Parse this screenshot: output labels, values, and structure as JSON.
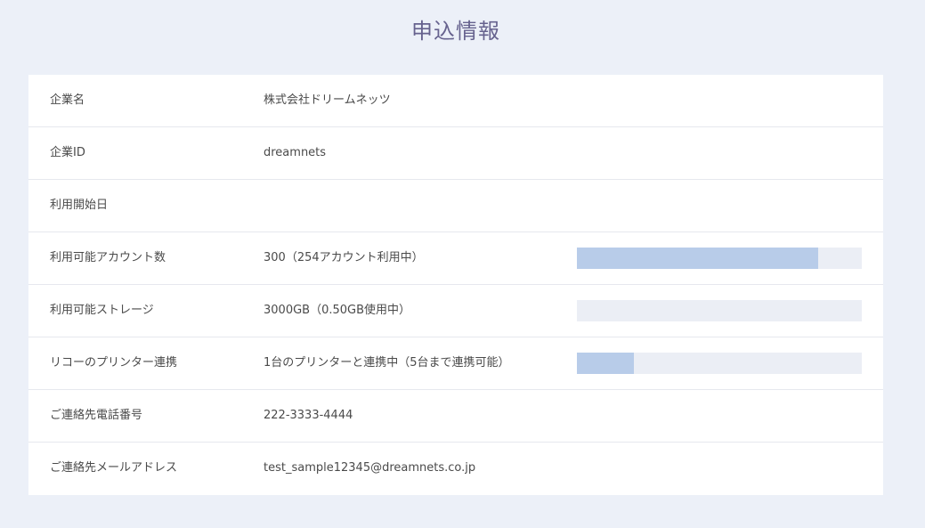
{
  "page": {
    "title": "申込情報"
  },
  "rows": [
    {
      "label": "企業名",
      "value": "株式会社ドリームネッツ"
    },
    {
      "label": "企業ID",
      "value": "dreamnets"
    },
    {
      "label": "利用開始日",
      "value": ""
    },
    {
      "label": "利用可能アカウント数",
      "value": "300（254アカウント利用中）",
      "usage_fraction": 0.846
    },
    {
      "label": "利用可能ストレージ",
      "value": "3000GB（0.50GB使用中）",
      "usage_fraction": 0.0002
    },
    {
      "label": "リコーのプリンター連携",
      "value": "1台のプリンターと連携中（5台まで連携可能）",
      "usage_fraction": 0.2
    },
    {
      "label": "ご連絡先電話番号",
      "value": "222-3333-4444"
    },
    {
      "label": "ご連絡先メールアドレス",
      "value": "test_sample12345@dreamnets.co.jp"
    }
  ],
  "colors": {
    "background": "#ecf0f8",
    "title": "#66628e",
    "bar_track": "#ebeef5",
    "bar_fill": "#b8cce9"
  }
}
